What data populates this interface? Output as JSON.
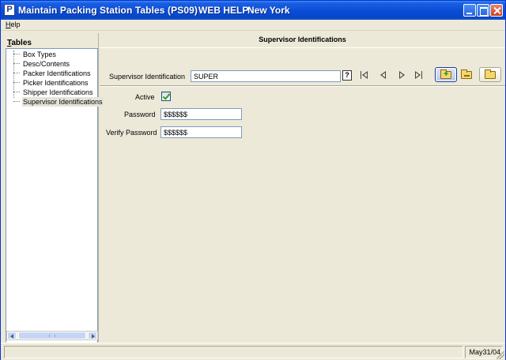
{
  "window": {
    "title": "Maintain Packing Station Tables (PS09)",
    "help_link": "WEB HELP",
    "location": "New York",
    "app_icon_letter": "P"
  },
  "menu": {
    "items": [
      {
        "label": "Help"
      }
    ]
  },
  "tables_panel": {
    "label": "Tables",
    "items": [
      {
        "label": "Box Types",
        "selected": false
      },
      {
        "label": "Desc/Contents",
        "selected": false
      },
      {
        "label": "Packer Identifications",
        "selected": false
      },
      {
        "label": "Picker Identifications",
        "selected": false
      },
      {
        "label": "Shipper Identifications",
        "selected": false
      },
      {
        "label": "Supervisor Identifications",
        "selected": true
      }
    ]
  },
  "form": {
    "title": "Supervisor Identifications",
    "supervisor_id_label": "Supervisor Identification",
    "supervisor_id_value": "SUPER",
    "help_button": "?",
    "active_label": "Active",
    "active_checked": true,
    "password_label": "Password",
    "password_value": "$$$$$$",
    "verify_password_label": "Verify Password",
    "verify_password_value": "$$$$$$"
  },
  "toolbar": {
    "buttons": [
      {
        "icon": "add-folder-icon"
      },
      {
        "icon": "remove-folder-icon"
      },
      {
        "icon": "open-folder-icon"
      }
    ]
  },
  "navigation": {
    "buttons": [
      "first-record-icon",
      "previous-record-icon",
      "next-record-icon",
      "last-record-icon"
    ]
  },
  "statusbar": {
    "message": "",
    "date": "May31/04"
  },
  "colors": {
    "titlebar": "#0a4fd8",
    "window_bg": "#ece9d8",
    "field_border": "#7f9db9",
    "checkmark": "#21a121"
  }
}
